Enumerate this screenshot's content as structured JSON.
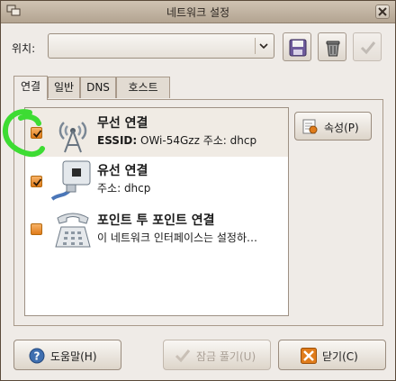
{
  "window": {
    "title": "네트워크 설정"
  },
  "location": {
    "label": "위치:",
    "value": ""
  },
  "tabs": [
    {
      "label": "연결"
    },
    {
      "label": "일반"
    },
    {
      "label": "DNS"
    },
    {
      "label": "호스트"
    }
  ],
  "connections": [
    {
      "name": "무선 연결",
      "detail_key": "ESSID:",
      "detail": "OWi-54Gzz 주소: dhcp",
      "checked": true,
      "icon": "wireless-antenna-icon"
    },
    {
      "name": "유선 연결",
      "detail": "주소: dhcp",
      "checked": true,
      "icon": "ethernet-plug-icon"
    },
    {
      "name": "포인트 투 포인트 연결",
      "detail": "이 네트워크 인터페이스는 설정하…",
      "checked": false,
      "icon": "modem-phone-icon"
    }
  ],
  "buttons": {
    "properties": "속성(P)",
    "help": "도움말(H)",
    "unlock": "잠금 풀기(U)",
    "close": "닫기(C)"
  },
  "colors": {
    "accent": "#e07c1b",
    "annotation": "#3ddc33"
  }
}
